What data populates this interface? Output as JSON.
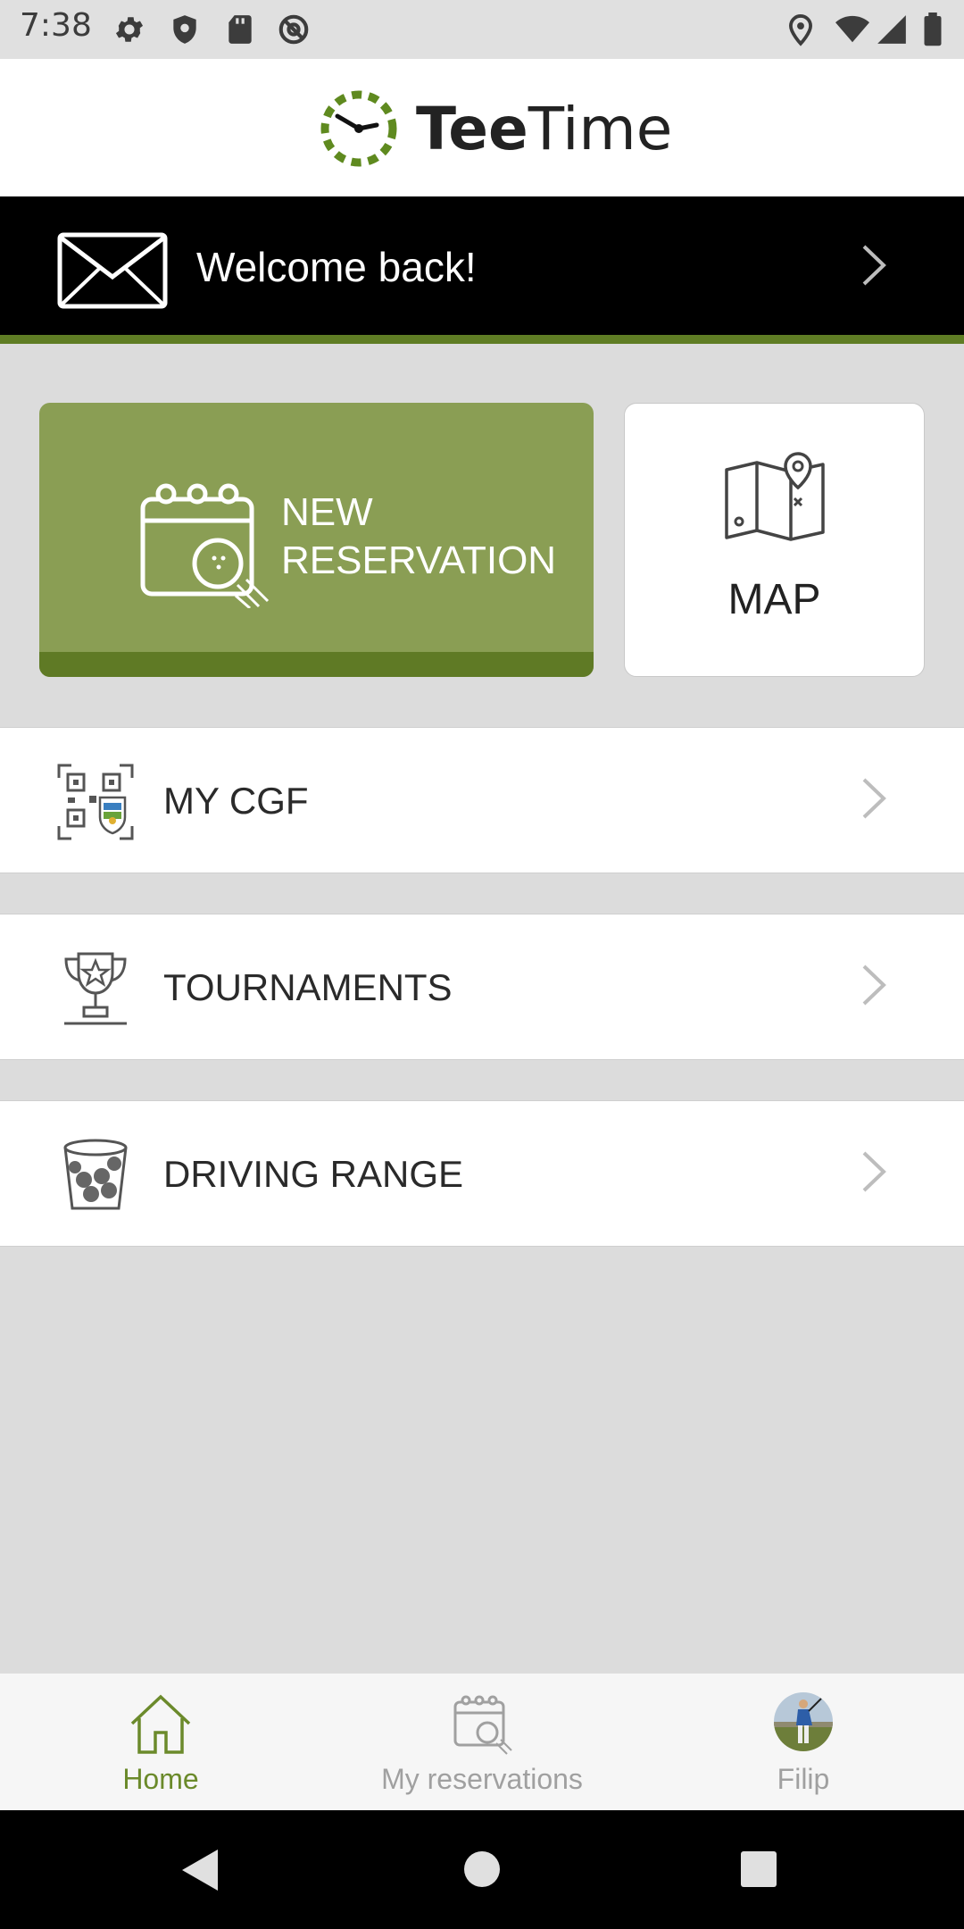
{
  "status_bar": {
    "time": "7:38",
    "icons": [
      "gear-icon",
      "shield-icon",
      "sd-card-icon",
      "at-sign-icon",
      "location-pin-icon",
      "wifi-icon",
      "cell-signal-icon",
      "battery-icon"
    ]
  },
  "header": {
    "logo_text_bold": "Tee",
    "logo_text_regular": "Time",
    "logo_icon": "clock-icon"
  },
  "banner": {
    "text": "Welcome back!",
    "icon": "mail-icon"
  },
  "tiles": {
    "new_reservation": {
      "line1": "NEW",
      "line2": "RESERVATION",
      "icon": "calendar-golf-icon"
    },
    "map": {
      "label": "MAP",
      "icon": "map-pin-icon"
    }
  },
  "menu": [
    {
      "label": "MY CGF",
      "icon": "qr-badge-icon"
    },
    {
      "label": "TOURNAMENTS",
      "icon": "trophy-icon"
    },
    {
      "label": "DRIVING RANGE",
      "icon": "ball-bucket-icon"
    }
  ],
  "tabbar": {
    "home": {
      "label": "Home",
      "active": true
    },
    "reservations": {
      "label": "My reservations",
      "active": false
    },
    "profile": {
      "label": "Filip",
      "active": false
    }
  },
  "colors": {
    "accent": "#6b8a2b",
    "tile_green": "#8a9e54",
    "tile_green_dark": "#5f7a25",
    "inactive_tab": "#a0a0a0"
  }
}
